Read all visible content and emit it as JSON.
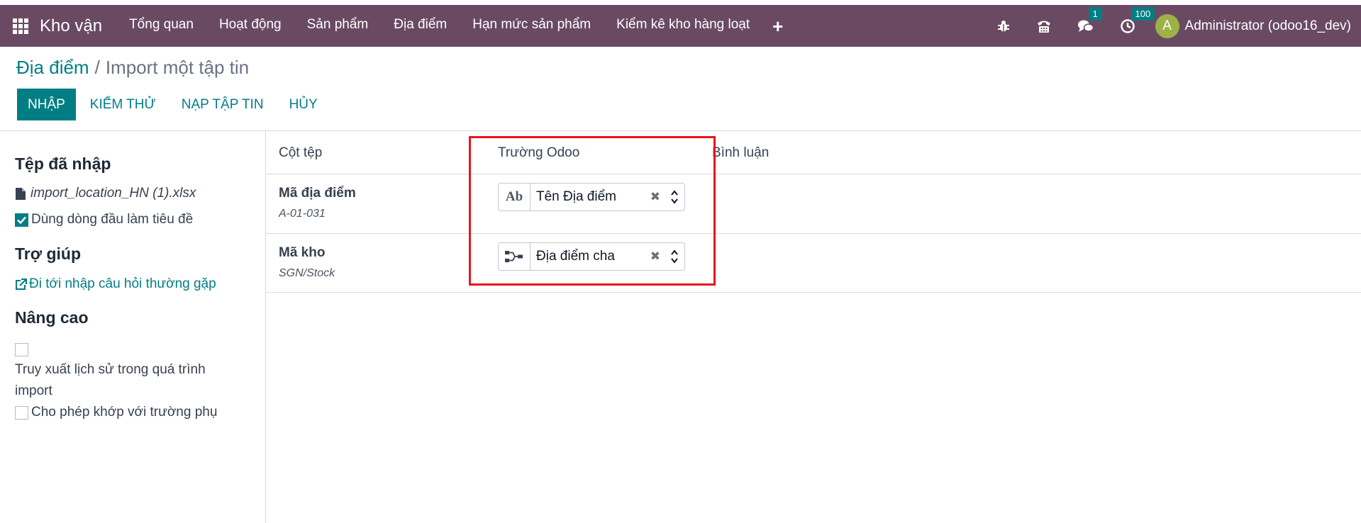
{
  "navbar": {
    "brand": "Kho vận",
    "menu": [
      "Tổng quan",
      "Hoạt động",
      "Sản phẩm",
      "Địa điểm",
      "Hạn mức sản phẩm",
      "Kiểm kê kho hàng loạt"
    ],
    "plus": "+",
    "messages_count": "1",
    "activities_count": "100",
    "avatar_initial": "A",
    "user": "Administrator (odoo16_dev)"
  },
  "breadcrumb": {
    "parent": "Địa điểm",
    "separator": "/",
    "current": "Import một tập tin"
  },
  "actions": {
    "import": "NHẬP",
    "test": "KIỂM THỬ",
    "load_file": "NẠP TẬP TIN",
    "cancel": "HỦY"
  },
  "sidebar": {
    "imported_heading": "Tệp đã nhập",
    "file_name": "import_location_HN (1).xlsx",
    "use_first_row": "Dùng dòng đầu làm tiêu đề",
    "help_heading": "Trợ giúp",
    "faq_link": "Đi tới nhập câu hỏi thường gặp",
    "advanced_heading": "Nâng cao",
    "track_history": "Truy xuất lịch sử trong quá trình import",
    "allow_subfields": "Cho phép khớp với trường phụ"
  },
  "table": {
    "headers": {
      "file_column": "Cột tệp",
      "odoo_field": "Trường Odoo",
      "comments": "Bình luận"
    },
    "rows": [
      {
        "name": "Mã địa điểm",
        "sample": "A-01-031",
        "field": "Tên Địa điểm",
        "field_type_icon": "text-ab-icon"
      },
      {
        "name": "Mã kho",
        "sample": "SGN/Stock",
        "field": "Địa điểm cha",
        "field_type_icon": "relation-icon"
      }
    ]
  },
  "colors": {
    "navbar": "#6a4a63",
    "accent": "#017e84",
    "highlight": "#e8151b",
    "avatar": "#9db146"
  }
}
